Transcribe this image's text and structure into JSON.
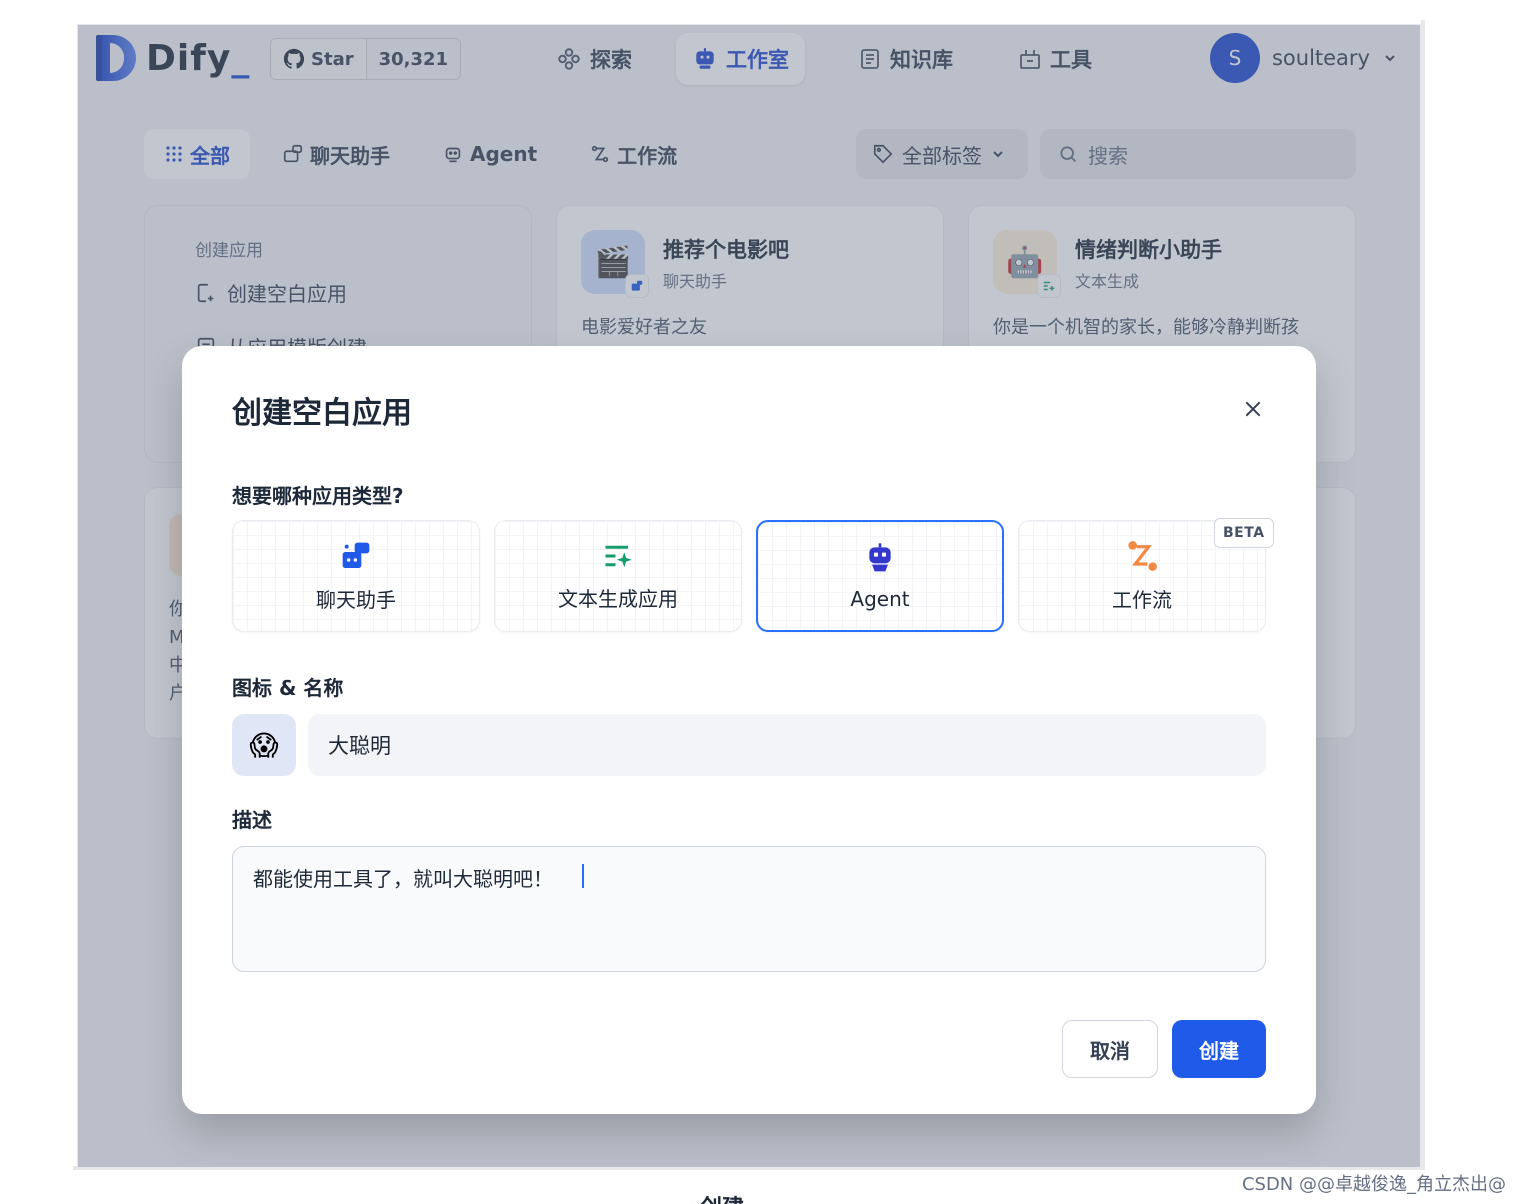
{
  "header": {
    "logo_text": "Dify",
    "github": {
      "star_label": "Star",
      "count": "30,321"
    },
    "nav": [
      {
        "label": "探索",
        "icon": "explore-icon"
      },
      {
        "label": "工作室",
        "icon": "robot-icon",
        "active": true
      },
      {
        "label": "知识库",
        "icon": "book-icon"
      },
      {
        "label": "工具",
        "icon": "toolbox-icon"
      }
    ],
    "user": {
      "initial": "S",
      "name": "soulteary"
    }
  },
  "filters": {
    "tabs": [
      {
        "label": "全部",
        "active": true
      },
      {
        "label": "聊天助手"
      },
      {
        "label": "Agent"
      },
      {
        "label": "工作流"
      }
    ],
    "tag_filter": "全部标签",
    "search_placeholder": "搜索"
  },
  "background_cards": {
    "create": {
      "title": "创建应用",
      "items": [
        "创建空白应用",
        "从应用模版创建"
      ]
    },
    "apps": [
      {
        "name": "推荐个电影吧",
        "type": "聊天助手",
        "desc": "电影爱好者之友",
        "emoji": "🎬"
      },
      {
        "name": "情绪判断小助手",
        "type": "文本生成",
        "desc": "你是一个机智的家长，能够冷静判断孩",
        "emoji": "🤖"
      }
    ],
    "row2_fragments": [
      "你",
      "M",
      "中",
      "户"
    ]
  },
  "modal": {
    "title": "创建空白应用",
    "type_question": "想要哪种应用类型?",
    "types": [
      {
        "label": "聊天助手",
        "icon": "chat-assistant-icon",
        "color": "#1f5ae8"
      },
      {
        "label": "文本生成应用",
        "icon": "text-generation-icon",
        "color": "#159e6b"
      },
      {
        "label": "Agent",
        "icon": "agent-robot-icon",
        "color": "#3538cd",
        "selected": true
      },
      {
        "label": "工作流",
        "icon": "workflow-icon",
        "color": "#f38744",
        "badge": "BETA"
      }
    ],
    "name_label": "图标 & 名称",
    "icon_emoji": "😱",
    "name_value": "大聪明",
    "desc_label": "描述",
    "desc_value": "都能使用工具了，就叫大聪明吧！",
    "cancel_label": "取消",
    "create_label": "创建"
  },
  "caption": "创建",
  "watermark": "CSDN @@卓越俊逸_角立杰出@"
}
